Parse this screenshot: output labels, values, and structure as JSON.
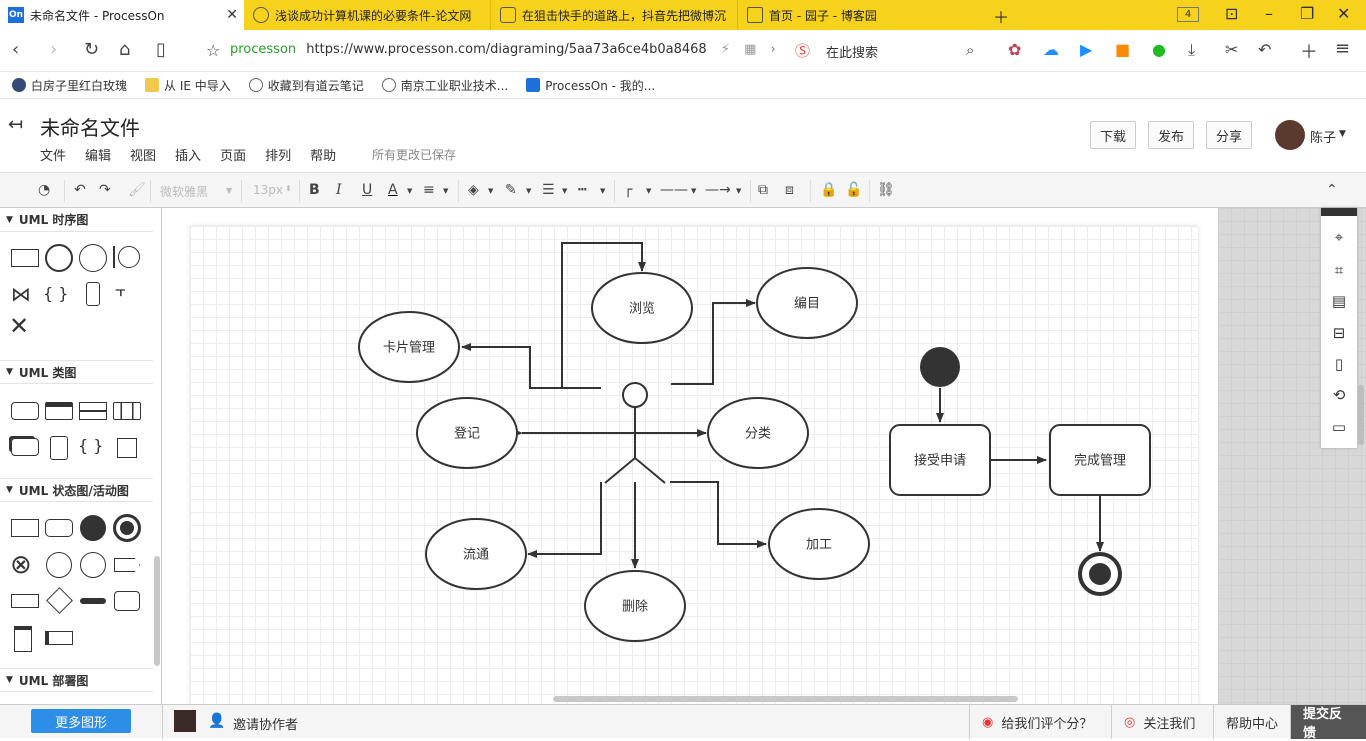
{
  "browser": {
    "tabs": [
      {
        "label": "未命名文件 - ProcessOn",
        "active": true
      },
      {
        "label": "浅谈成功计算机课的必要条件-论文网",
        "active": false
      },
      {
        "label": "在狙击快手的道路上，抖音先把微博沉",
        "active": false
      },
      {
        "label": "首页 - 园子 - 博客园",
        "active": false
      }
    ],
    "tab_count": "4",
    "url_host": "processon",
    "url": "https://www.processon.com/diagraming/5aa73a6ce4b0a8468",
    "search_placeholder": "在此搜索",
    "bookmarks": [
      "白房子里红白玫瑰",
      "从 IE 中导入",
      "收藏到有道云笔记",
      "南京工业职业技术...",
      "ProcessOn - 我的..."
    ]
  },
  "app": {
    "title": "未命名文件",
    "menu": [
      "文件",
      "编辑",
      "视图",
      "插入",
      "页面",
      "排列",
      "帮助"
    ],
    "save_status": "所有更改已保存",
    "buttons": {
      "download": "下载",
      "publish": "发布",
      "share": "分享"
    },
    "user_name": "陈子"
  },
  "toolbar": {
    "font_family": "微软雅黑",
    "font_size": "13px"
  },
  "sidebar": {
    "sections": [
      "UML 时序图",
      "UML 类图",
      "UML 状态图/活动图",
      "UML 部署图"
    ],
    "more_shapes": "更多图形"
  },
  "diagram": {
    "ellipses": [
      "浏览",
      "编目",
      "卡片管理",
      "登记",
      "分类",
      "流通",
      "删除",
      "加工"
    ],
    "states": [
      "接受申请",
      "完成管理"
    ]
  },
  "footer": {
    "invite": "邀请协作者",
    "rate": "给我们评个分？",
    "follow": "关注我们",
    "help": "帮助中心",
    "feedback": "提交反馈"
  }
}
